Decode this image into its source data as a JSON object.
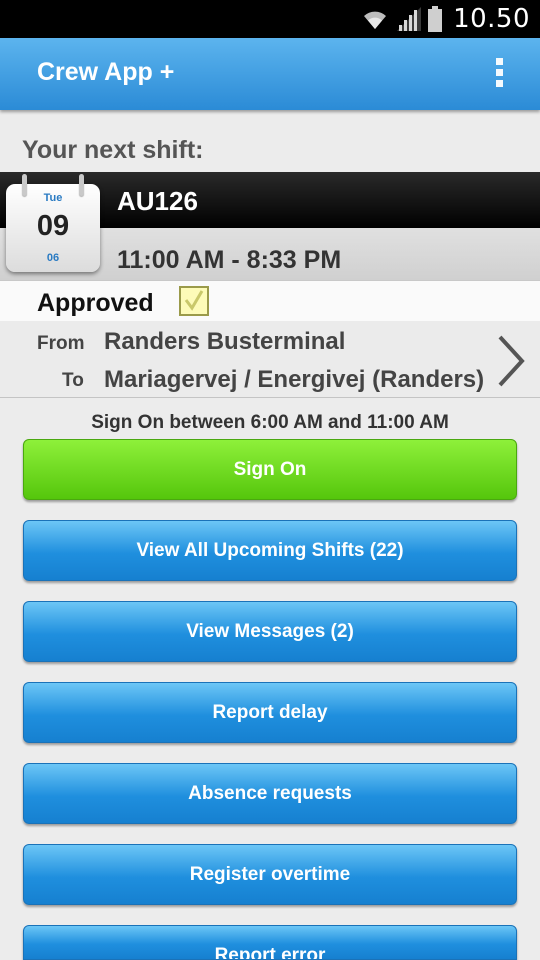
{
  "status_bar": {
    "time": "10.50",
    "icons": [
      "wifi-icon",
      "signal-icon",
      "battery-icon"
    ]
  },
  "app_bar": {
    "title": "Crew App +",
    "overflow_icon": "overflow-menu-icon"
  },
  "next_shift": {
    "heading": "Your next shift:",
    "calendar": {
      "weekday": "Tue",
      "day": "09",
      "month": "06"
    },
    "code": "AU126",
    "time": "11:00 AM - 8:33 PM",
    "status_label": "Approved",
    "approved": true,
    "from_label": "From",
    "from_value": "Randers Busterminal",
    "to_label": "To",
    "to_value": "Mariagervej / Energivej (Randers)"
  },
  "sign_on_info": "Sign On between 6:00 AM and 11:00 AM",
  "buttons": {
    "sign_on": "Sign On",
    "view_upcoming": "View All Upcoming Shifts (22)",
    "view_messages": "View Messages (2)",
    "report_delay": "Report delay",
    "absence_requests": "Absence requests",
    "register_overtime": "Register overtime",
    "report_error": "Report error"
  },
  "colors": {
    "app_bar": "#3a9ae2",
    "green_button": "#6ad91e",
    "blue_button": "#1f8fde",
    "calendar_accent": "#2a7bc3"
  }
}
